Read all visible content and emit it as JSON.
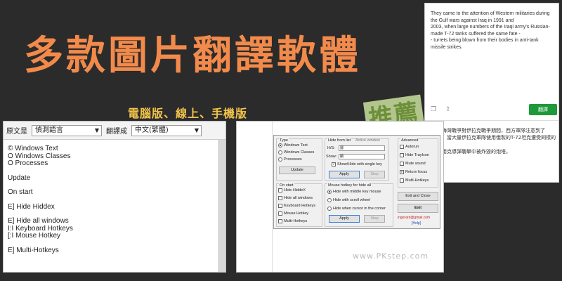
{
  "headline": "多款圖片翻譯軟體",
  "subline": "電腦版、線上、手機版",
  "stamp": "推薦",
  "watermark": "www.PKstep.com",
  "card": {
    "text_lines": [
      "They came to the attention of Western militaries during",
      "the Gulf wars against Iraq in 1991 and",
      "2003, when large numbers of the Iraqi army's Russian-",
      "made T-72 tanks suffered the same fate -",
      "- turrets being blown from their bodies in anti-tank",
      "missile strikes."
    ],
    "translate_label": "翻譯",
    "copy_icon": "copy-icon",
    "share_icon": "share-icon",
    "cn_lines": [
      "海灣戰爭對伊拉克戰爭期間，西方軍隊注意到了",
      "，當大量伊拉克軍隊使用俄製的T-72坦克遭受同樣的",
      "",
      "用克導彈襲擊中被炸毀的炮塔。"
    ]
  },
  "translator": {
    "source_label": "原文是",
    "source_value": "偵測語言",
    "target_label": "翻譯成",
    "target_value": "中文(繁體)",
    "lines": [
      "© Windows Text",
      "O Windows Classes",
      "O Processes",
      "",
      "Update",
      "",
      "On start",
      "",
      "E] Hide Hiddex",
      "",
      "E] Hide all windows",
      "I:I Keyboard Hotkeys",
      "[:I Mouse Hotkey",
      "",
      "E] Multi-Hotkeys"
    ]
  },
  "dialog": {
    "type_title": "Type",
    "type_opts": [
      "Windows Text",
      "Windows Classes",
      "Processes"
    ],
    "update_label": "Update",
    "hide_from_list_title": "Hide from list",
    "active_window_label": "Active window",
    "hs_label": "H/S:",
    "hs_value": "隱",
    "show_label": "Show:",
    "show_value": "顯",
    "show_hide_single": "Show/Hide with single key",
    "apply_label": "Apply",
    "stop_label": "Stop",
    "advanced_title": "Advanced",
    "advanced_opts": [
      "Autorun",
      "Hide TrayIcon",
      "Mute sound",
      "Return focus",
      "Multi-Hotkeys"
    ],
    "advanced_checked": [
      false,
      false,
      false,
      true,
      false
    ],
    "on_start_title": "On start",
    "on_start_opts": [
      "Hide HiddeX",
      "Hide all windows",
      "Keyboard Hotkeys",
      "Mouse Hotkey",
      "Multi-Hotkeys"
    ],
    "mouse_title": "Mouse hotkey for hide all",
    "mouse_opts": [
      "Hide with middle key mouse",
      "Hide with scroll wheel",
      "Hide when cursor in the corner"
    ],
    "exit_close_label": "Exit and Close",
    "exit_label": "Exit",
    "email": "ingerard@gmail.com",
    "help": "[Help]"
  },
  "colors": {
    "headline": "#f28a4b",
    "subline": "#f2c44c",
    "translate_btn": "#1e9a3a",
    "stamp_bg": "#bed296",
    "stamp_fg": "#6d8f3a"
  }
}
